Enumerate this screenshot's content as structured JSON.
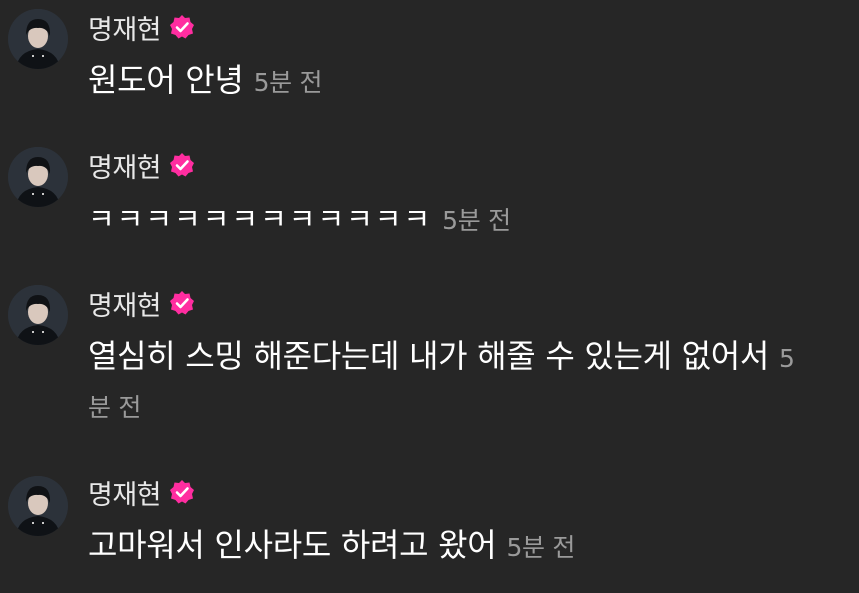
{
  "messages": [
    {
      "author": "명재현",
      "text": "원도어 안녕",
      "time": "5분 전",
      "avatar_icon": "profile-avatar",
      "badge_icon": "verified-check-icon",
      "badge_color": "#ff2da0"
    },
    {
      "author": "명재현",
      "text": "ㅋㅋㅋㅋㅋㅋㅋㅋㅋㅋㅋㅋ",
      "time": "5분 전",
      "avatar_icon": "profile-avatar",
      "badge_icon": "verified-check-icon",
      "badge_color": "#ff2da0"
    },
    {
      "author": "명재현",
      "text": "열심히 스밍 해준다는데 내가 해줄 수 있는게 없어서",
      "time": "5분 전",
      "avatar_icon": "profile-avatar",
      "badge_icon": "verified-check-icon",
      "badge_color": "#ff2da0"
    },
    {
      "author": "명재현",
      "text": "고마워서 인사라도 하려고 왔어",
      "time": "5분 전",
      "avatar_icon": "profile-avatar",
      "badge_icon": "verified-check-icon",
      "badge_color": "#ff2da0"
    }
  ],
  "colors": {
    "background": "#262626",
    "text": "#ffffff",
    "name": "#e8e8e8",
    "timestamp": "#9a9a9a",
    "badge": "#ff2da0"
  }
}
